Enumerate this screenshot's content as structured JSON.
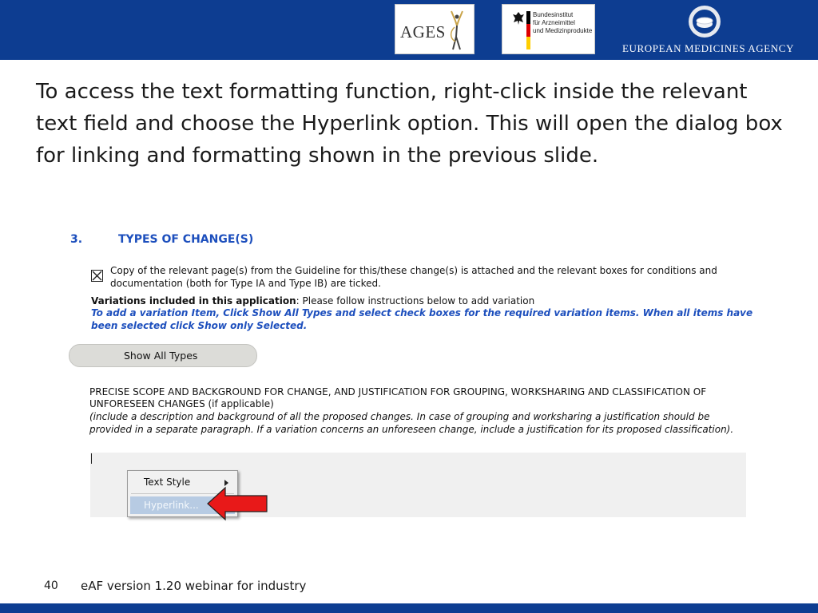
{
  "header": {
    "logos": {
      "ages": {
        "text": "AGES"
      },
      "bfarm": {
        "lines": [
          "Bundesinstitut",
          "für Arzneimittel",
          "und Medizinprodukte"
        ]
      },
      "ema": {
        "text": "EUROPEAN MEDICINES AGENCY"
      }
    },
    "colors": {
      "brand_blue": "#0d3d91",
      "link_blue": "#1d4fbd",
      "highlight": "#b7cbe3",
      "arrow_red": "#e81919"
    }
  },
  "slide": {
    "body_text": "To access the text formatting function, right-click inside the relevant text field and choose the Hyperlink option. This will open the dialog box for linking and formatting shown in the previous slide."
  },
  "form": {
    "section_number": "3.",
    "section_title": "TYPES OF CHANGE(S)",
    "checkbox_checked": true,
    "copy_text": "Copy of the relevant page(s) from the Guideline for this/these change(s) is attached and the relevant boxes for conditions and documentation (both for Type IA and Type IB) are ticked.",
    "variations_label": "Variations included in this application",
    "variations_hint": ": Please follow instructions below to add variation",
    "variations_instruction": "To add a variation Item, Click Show All Types and select check boxes for the required variation items. When all items have been selected click Show only Selected.",
    "show_all_button": "Show All Types",
    "scope_title": "PRECISE SCOPE AND BACKGROUND FOR CHANGE, AND JUSTIFICATION FOR GROUPING, WORKSHARING AND CLASSIFICATION OF UNFORESEEN CHANGES (if applicable)",
    "scope_hint": "(include a description and background of all the proposed changes. In case of grouping and worksharing a justification should be provided in a separate paragraph. If a variation concerns an unforeseen change, include a justification for its proposed classification).",
    "text_area_value": ""
  },
  "context_menu": {
    "items": [
      {
        "label": "Text Style",
        "has_submenu": true
      },
      {
        "label": "Hyperlink...",
        "highlighted": true
      }
    ]
  },
  "footer": {
    "page_number": "40",
    "text": "eAF version 1.20 webinar for industry"
  }
}
